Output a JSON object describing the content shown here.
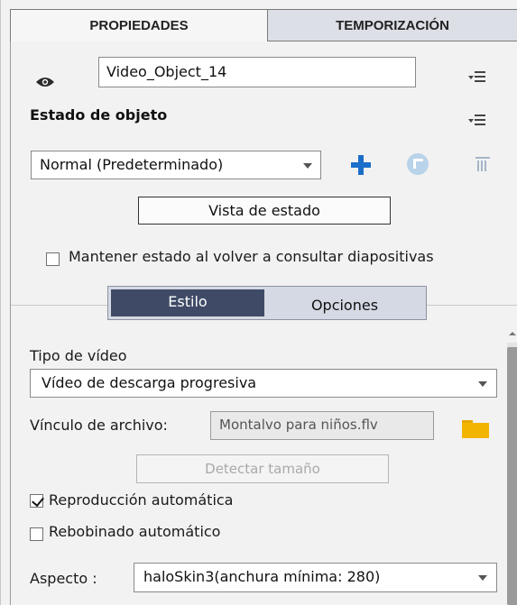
{
  "tabs": {
    "properties": "PROPIEDADES",
    "timing": "TEMPORIZACIÓN"
  },
  "object": {
    "name": "Video_Object_14"
  },
  "state": {
    "title": "Estado de objeto",
    "selected": "Normal (Predeterminado)",
    "view_button": "Vista de estado",
    "keep_state_label": "Mantener estado al volver a consultar diapositivas",
    "keep_state_checked": false
  },
  "segmented": {
    "style": "Estilo",
    "options": "Opciones",
    "active": "Estilo"
  },
  "video": {
    "type_label": "Tipo de vídeo",
    "type_value": "Vídeo de descarga progresiva",
    "file_label": "Vínculo de archivo:",
    "file_value": "Montalvo para niños.flv",
    "detect_button": "Detectar tamaño",
    "autoplay_label": "Reproducción automática",
    "autoplay_checked": true,
    "autorewind_label": "Rebobinado automático",
    "autorewind_checked": false,
    "aspect_label": "Aspecto :",
    "aspect_value": "haloSkin3(anchura mínima: 280)"
  },
  "icons": {
    "visibility": "eye-icon",
    "menu": "panel-menu-icon",
    "add": "plus-icon",
    "reset": "reset-state-icon",
    "delete": "trash-icon",
    "browse": "folder-icon"
  },
  "colors": {
    "accent_blue": "#1b6fc9",
    "segment_active": "#3f4b66",
    "folder": "#f2b400",
    "panel_bg": "#f2f2f2"
  }
}
